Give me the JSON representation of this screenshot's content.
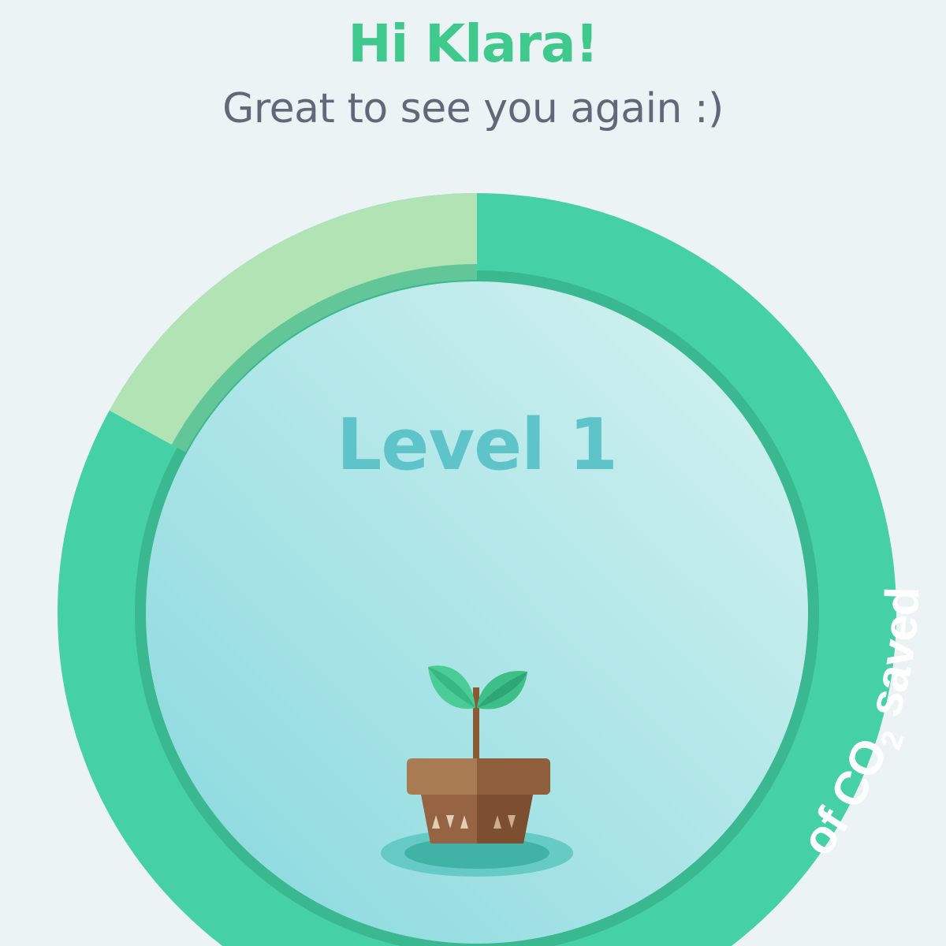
{
  "greeting": {
    "title": "Hi Klara!",
    "subtitle": "Great to see you again :)"
  },
  "level": {
    "label": "Level 1",
    "progress_fraction": 0.83
  },
  "co2_badge": {
    "text_before": "of CO",
    "subscript": "2",
    "text_after": " saved"
  },
  "plant_icon": "potted-seedling-icon",
  "colors": {
    "accent_green": "#3fc98c",
    "ring_progress": "#45d0a5",
    "ring_remaining": "#b2e3b4",
    "level_text": "#5fc4c9",
    "subtitle_text": "#626879",
    "background": "#ecf3f5"
  }
}
